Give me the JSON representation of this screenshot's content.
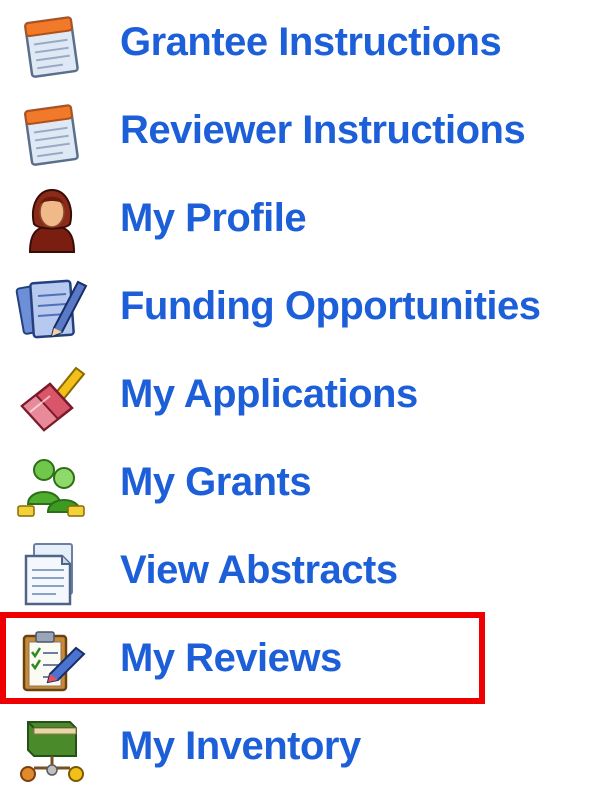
{
  "menu": {
    "items": [
      {
        "label": "Grantee Instructions",
        "icon": "document-calendar-icon"
      },
      {
        "label": "Reviewer Instructions",
        "icon": "document-calendar-icon"
      },
      {
        "label": "My Profile",
        "icon": "user-profile-icon"
      },
      {
        "label": "Funding Opportunities",
        "icon": "notepad-pencil-icon"
      },
      {
        "label": "My Applications",
        "icon": "eraser-pencil-icon"
      },
      {
        "label": "My Grants",
        "icon": "money-people-icon"
      },
      {
        "label": "View Abstracts",
        "icon": "document-page-icon"
      },
      {
        "label": "My Reviews",
        "icon": "clipboard-checklist-icon"
      },
      {
        "label": "My Inventory",
        "icon": "book-network-icon"
      }
    ],
    "highlighted_item": "My Reviews"
  },
  "colors": {
    "link": "#1c5fd8",
    "highlight_border": "#ee0000",
    "background": "#ffffff"
  }
}
